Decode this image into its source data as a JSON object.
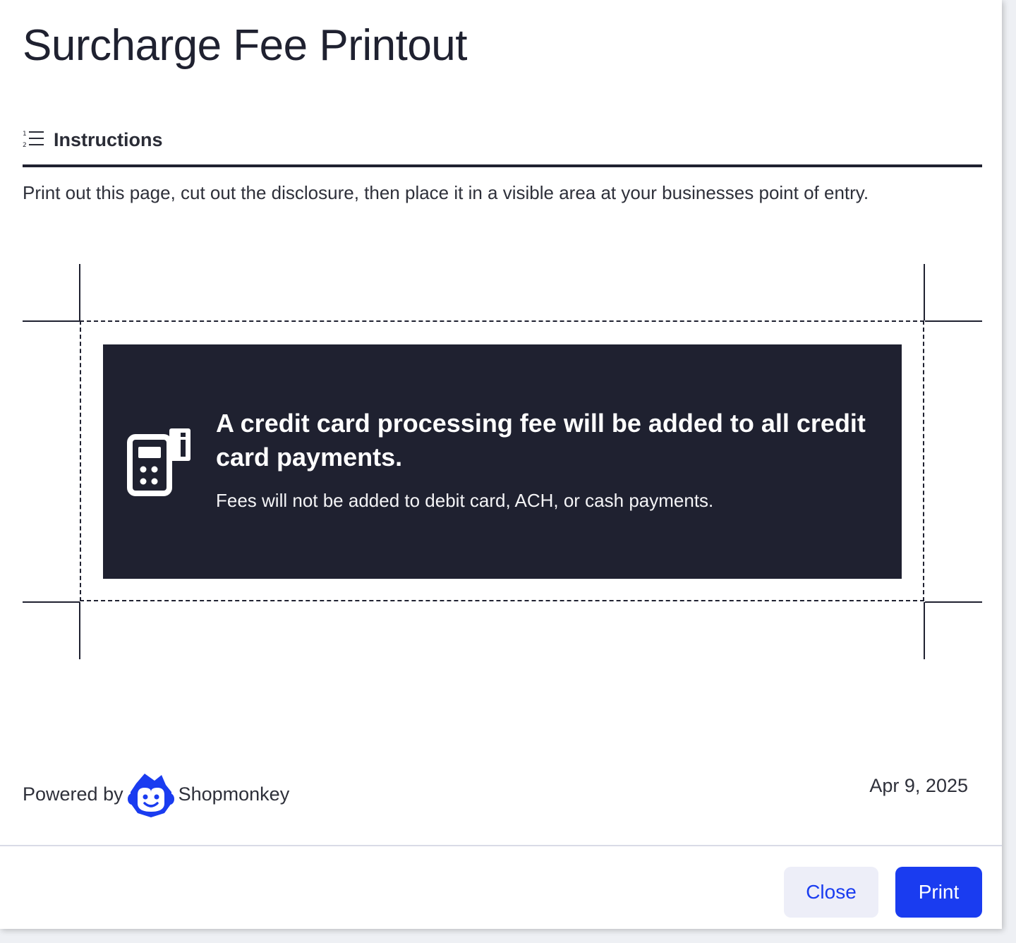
{
  "modal": {
    "title": "Surcharge Fee Printout"
  },
  "instructions": {
    "label": "Instructions",
    "icon": "numbered-list-icon",
    "text": "Print out this page, cut out the disclosure, then place it in a visible area at your businesses point of entry."
  },
  "disclosure": {
    "icon": "card-terminal-icon",
    "heading": "A credit card processing fee will be added to all credit card payments.",
    "subtext": "Fees will not be added to debit card, ACH, or cash payments.",
    "background_color": "#1f2130"
  },
  "footer_info": {
    "powered_by": "Powered by",
    "brand": "Shopmonkey",
    "brand_logo": "shopmonkey-logo",
    "brand_color": "#1a3cf0",
    "date": "Apr 9, 2025"
  },
  "actions": {
    "close_label": "Close",
    "print_label": "Print",
    "accent_color": "#1a3cf0"
  }
}
